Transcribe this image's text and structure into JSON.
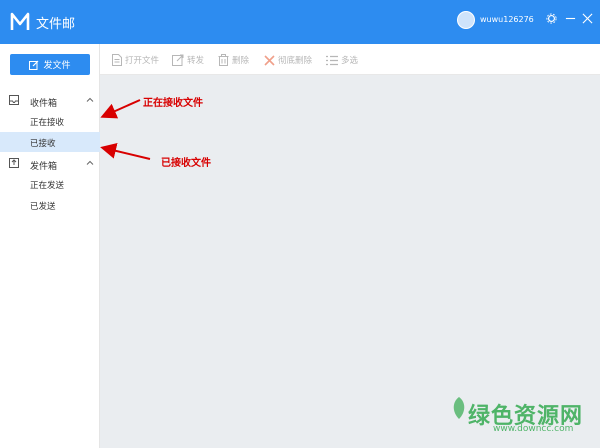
{
  "app": {
    "title": "文件邮",
    "username": "wuwu126276"
  },
  "sidebar": {
    "send_button": "发文件",
    "inbox": {
      "label": "收件箱",
      "items": [
        "正在接收",
        "已接收"
      ]
    },
    "outbox": {
      "label": "发件箱",
      "items": [
        "正在发送",
        "已发送"
      ]
    }
  },
  "toolbar": {
    "open": "打开文件",
    "forward": "转发",
    "delete": "删除",
    "delete_all": "彻底删除",
    "multi": "多选"
  },
  "annotations": {
    "receiving": "正在接收文件",
    "received": "已接收文件"
  },
  "watermark": {
    "name": "绿色资源网",
    "url": "www.downcc.com"
  },
  "colors": {
    "accent": "#2d8cf0",
    "annotation": "#d80000",
    "watermark": "#3fae5a"
  }
}
